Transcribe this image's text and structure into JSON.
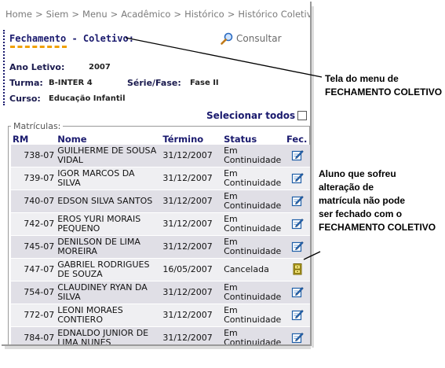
{
  "breadcrumb": [
    "Home",
    "Siem",
    "Menu",
    "Acadêmico",
    "Histórico",
    "Histórico Coletivo"
  ],
  "breadcrumb_sep": ">",
  "title": "Fechamento - Coletivo:",
  "consultar_label": "Consultar",
  "form": {
    "ano_label": "Ano Letivo:",
    "ano_value": "2007",
    "turma_label": "Turma:",
    "turma_value": "B-INTER 4",
    "serie_label": "Série/Fase:",
    "serie_value": "Fase II",
    "curso_label": "Curso:",
    "curso_value": "Educação Infantil"
  },
  "select_all_label": "Selecionar todos",
  "matriculas_legend": "Matrículas:",
  "table": {
    "headers": [
      "RM",
      "Nome",
      "Término",
      "Status",
      "Fec."
    ],
    "rows": [
      {
        "rm": "738-07",
        "nome": "GUILHERME DE SOUSA VIDAL",
        "termino": "31/12/2007",
        "status": "Em Continuidade",
        "fec": "edit"
      },
      {
        "rm": "739-07",
        "nome": "IGOR MARCOS DA SILVA",
        "termino": "31/12/2007",
        "status": "Em Continuidade",
        "fec": "edit"
      },
      {
        "rm": "740-07",
        "nome": "EDSON SILVA SANTOS",
        "termino": "31/12/2007",
        "status": "Em Continuidade",
        "fec": "edit"
      },
      {
        "rm": "742-07",
        "nome": "EROS YURI MORAIS PEQUENO",
        "termino": "31/12/2007",
        "status": "Em Continuidade",
        "fec": "edit"
      },
      {
        "rm": "745-07",
        "nome": "DENILSON DE LIMA MOREIRA",
        "termino": "31/12/2007",
        "status": "Em Continuidade",
        "fec": "edit"
      },
      {
        "rm": "747-07",
        "nome": "GABRIEL RODRIGUES DE SOUZA",
        "termino": "16/05/2007",
        "status": "Cancelada",
        "fec": "locked"
      },
      {
        "rm": "754-07",
        "nome": "CLAUDINEY RYAN DA SILVA",
        "termino": "31/12/2007",
        "status": "Em Continuidade",
        "fec": "edit"
      },
      {
        "rm": "772-07",
        "nome": "LEONI MORAES CONTIERO",
        "termino": "31/12/2007",
        "status": "Em Continuidade",
        "fec": "edit"
      },
      {
        "rm": "784-07",
        "nome": "EDNALDO JUNIOR DE LIMA NUNES",
        "termino": "31/12/2007",
        "status": "Em Continuidade",
        "fec": "edit"
      }
    ]
  },
  "callouts": {
    "menu": [
      "Tela do menu de",
      "FECHAMENTO COLETIVO"
    ],
    "aluno": [
      "Aluno que sofreu",
      "alteração de",
      "matrícula não pode",
      "ser fechado com o",
      "FECHAMENTO COLETIVO"
    ]
  },
  "colors": {
    "title": "#1a1a6e",
    "accent_underline": "#f0a000",
    "row_bg": "#e0dfe6"
  }
}
